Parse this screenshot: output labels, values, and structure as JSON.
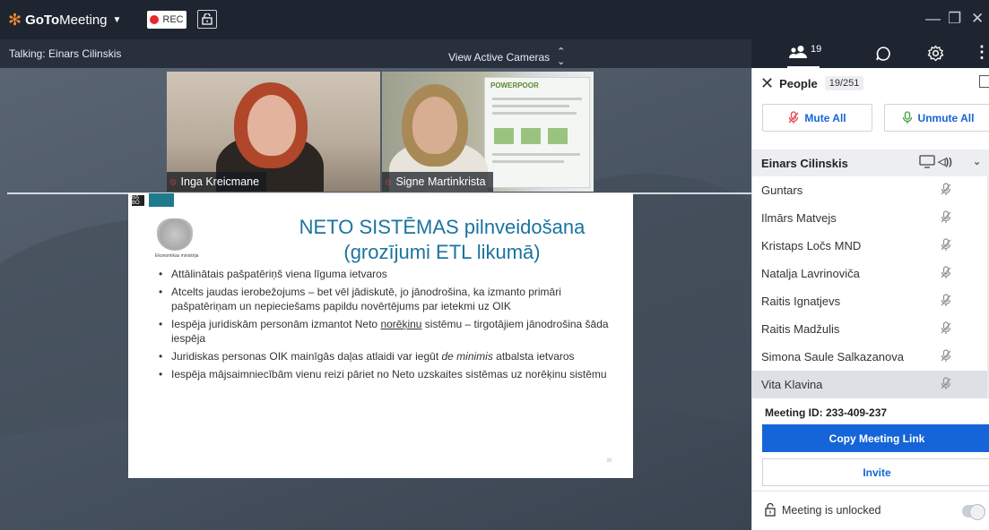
{
  "app": {
    "brand_go": "GoTo",
    "brand_meeting": "Meeting",
    "rec_label": "REC"
  },
  "status": {
    "talking": "Talking: Einars Cilinskis",
    "view_cameras": "View Active Cameras"
  },
  "toolbar": {
    "people_count": "19"
  },
  "cameras": [
    {
      "name": "Inga Kreicmane"
    },
    {
      "name": "Signe Martinkrista"
    }
  ],
  "poster": {
    "title": "POWERPOOR"
  },
  "slide": {
    "tag": "BĀ BŌ",
    "ministry": "Ekonomikas ministrija",
    "title_line1": "NETO SISTĒMAS pilnveidošana",
    "title_line2": "(grozījumi ETL likumā)",
    "bullets": [
      "Attālinātais pašpatēriņš viena līguma ietvaros",
      "Atcelts jaudas ierobežojums – bet vēl jādiskutē, jo jānodrošina, ka izmanto primāri pašpatēriņam un nepieciešams papildu novērtējums par ietekmi uz OIK",
      "Iespēja juridiskām personām izmantot Neto norēķinu sistēmu – tirgotājiem jānodrošina šāda iespēja",
      "Juridiskas personas OIK mainīgās daļas atlaidi var iegūt de minimis atbalsta ietvaros",
      "Iespēja mājsaimniecībām vienu reizi pāriet no Neto uzskaites sistēmas uz norēķinu sistēmu"
    ],
    "bullet2_part1": "Iespēja juridiskām personām izmantot Neto ",
    "bullet2_underline": "norēķinu",
    "bullet2_part2": " sistēmu – tirgotājiem jānodrošina šāda iespēja",
    "bullet3_part1": "Juridiskas personas OIK mainīgās daļas atlaidi var iegūt ",
    "bullet3_italic": "de minimis",
    "bullet3_part2": " atbalsta ietvaros",
    "page_number": "28"
  },
  "panel": {
    "title": "People",
    "count": "19/251",
    "mute_all": "Mute All",
    "unmute_all": "Unmute All",
    "presenter": "Einars Cilinskis",
    "people": [
      {
        "name": "Guntars"
      },
      {
        "name": "Ilmārs Matvejs"
      },
      {
        "name": "Kristaps Ločs MND"
      },
      {
        "name": "Natalja Lavrinoviča"
      },
      {
        "name": "Raitis Ignatjevs"
      },
      {
        "name": "Raitis Madžulis"
      },
      {
        "name": "Simona Saule Salkazanova"
      },
      {
        "name": "Vita Klavina"
      }
    ],
    "meeting_id": "Meeting ID:  233-409-237",
    "copy_link": "Copy Meeting Link",
    "invite": "Invite",
    "lock_status": "Meeting is unlocked"
  },
  "colors": {
    "brand_orange": "#f68d2e",
    "primary_blue": "#1565d8",
    "rec_red": "#e8242f",
    "slide_title_blue": "#1a73a0"
  },
  "icons": {
    "brand": "flower-icon",
    "rec": "record-dot-icon",
    "lock": "padlock-icon",
    "people": "people-icon",
    "chat": "chat-bubble-icon",
    "settings": "gear-icon",
    "mic_muted": "mic-off-icon",
    "mic_on": "mic-icon"
  }
}
